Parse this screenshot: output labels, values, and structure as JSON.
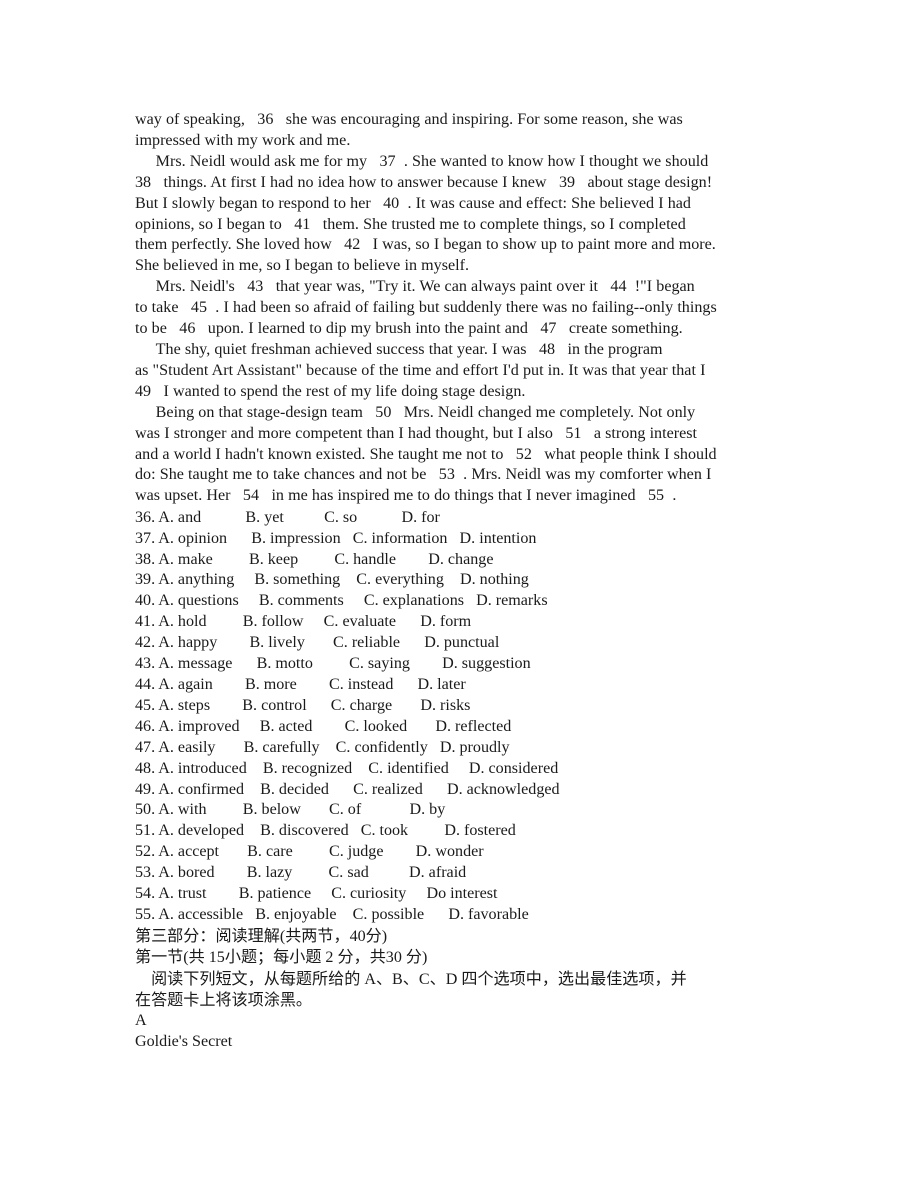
{
  "document": {
    "type": "scanned-exam-paper",
    "page_background": "#ffffff",
    "text_color": "#1a1a1a"
  },
  "cloze_passage": {
    "paragraphs": [
      "way of speaking,   36   she was encouraging and inspiring. For some reason, she was\nimpressed with my work and me.",
      "     Mrs. Neidl would ask me for my   37  . She wanted to know how I thought we should\n38   things. At first I had no idea how to answer because I knew   39   about stage design!\nBut I slowly began to respond to her   40  . It was cause and effect: She believed I had\nopinions, so I began to   41   them. She trusted me to complete things, so I completed\nthem perfectly. She loved how   42   I was, so I began to show up to paint more and more.\nShe believed in me, so I began to believe in myself.",
      "     Mrs. Neidl's   43   that year was, \"Try it. We can always paint over it   44  !\"I began\nto take   45  . I had been so afraid of failing but suddenly there was no failing--only things\nto be   46   upon. I learned to dip my brush into the paint and   47   create something.",
      "     The shy, quiet freshman achieved success that year. I was   48   in the program\nas \"Student Art Assistant\" because of the time and effort I'd put in. It was that year that I\n49   I wanted to spend the rest of my life doing stage design.",
      "     Being on that stage-design team   50   Mrs. Neidl changed me completely. Not only\nwas I stronger and more competent than I had thought, but I also   51   a strong interest\nand a world I hadn't known existed. She taught me not to   52   what people think I should\ndo: She taught me to take chances and not be   53  . Mrs. Neidl was my comforter when I\nwas upset. Her   54   in me has inspired me to do things that I never imagined   55  ."
    ]
  },
  "cloze_options": {
    "lines": [
      "36. A. and           B. yet          C. so           D. for",
      "37. A. opinion      B. impression   C. information   D. intention",
      "38. A. make         B. keep         C. handle        D. change",
      "39. A. anything     B. something    C. everything    D. nothing",
      "40. A. questions     B. comments     C. explanations   D. remarks",
      "41. A. hold         B. follow     C. evaluate      D. form",
      "42. A. happy        B. lively       C. reliable      D. punctual",
      "43. A. message      B. motto         C. saying        D. suggestion",
      "44. A. again        B. more        C. instead      D. later",
      "45. A. steps        B. control      C. charge       D. risks",
      "46. A. improved     B. acted        C. looked       D. reflected",
      "47. A. easily       B. carefully    C. confidently   D. proudly",
      "48. A. introduced    B. recognized    C. identified     D. considered",
      "49. A. confirmed    B. decided      C. realized      D. acknowledged",
      "50. A. with         B. below       C. of            D. by",
      "51. A. developed    B. discovered   C. took         D. fostered",
      "52. A. accept       B. care         C. judge        D. wonder",
      "53. A. bored        B. lazy         C. sad          D. afraid",
      "54. A. trust        B. patience     C. curiosity     Do interest",
      "55. A. accessible   B. enjoyable    C. possible      D. favorable"
    ],
    "items": [
      {
        "number": "36",
        "A": "and",
        "B": "yet",
        "C": "so",
        "D": "for"
      },
      {
        "number": "37",
        "A": "opinion",
        "B": "impression",
        "C": "information",
        "D": "intention"
      },
      {
        "number": "38",
        "A": "make",
        "B": "keep",
        "C": "handle",
        "D": "change"
      },
      {
        "number": "39",
        "A": "anything",
        "B": "something",
        "C": "everything",
        "D": "nothing"
      },
      {
        "number": "40",
        "A": "questions",
        "B": "comments",
        "C": "explanations",
        "D": "remarks"
      },
      {
        "number": "41",
        "A": "hold",
        "B": "follow",
        "C": "evaluate",
        "D": "form"
      },
      {
        "number": "42",
        "A": "happy",
        "B": "lively",
        "C": "reliable",
        "D": "punctual"
      },
      {
        "number": "43",
        "A": "message",
        "B": "motto",
        "C": "saying",
        "D": "suggestion"
      },
      {
        "number": "44",
        "A": "again",
        "B": "more",
        "C": "instead",
        "D": "later"
      },
      {
        "number": "45",
        "A": "steps",
        "B": "control",
        "C": "charge",
        "D": "risks"
      },
      {
        "number": "46",
        "A": "improved",
        "B": "acted",
        "C": "looked",
        "D": "reflected"
      },
      {
        "number": "47",
        "A": "easily",
        "B": "carefully",
        "C": "confidently",
        "D": "proudly"
      },
      {
        "number": "48",
        "A": "introduced",
        "B": "recognized",
        "C": "identified",
        "D": "considered"
      },
      {
        "number": "49",
        "A": "confirmed",
        "B": "decided",
        "C": "realized",
        "D": "acknowledged"
      },
      {
        "number": "50",
        "A": "with",
        "B": "below",
        "C": "of",
        "D": "by"
      },
      {
        "number": "51",
        "A": "developed",
        "B": "discovered",
        "C": "took",
        "D": "fostered"
      },
      {
        "number": "52",
        "A": "accept",
        "B": "care",
        "C": "judge",
        "D": "wonder"
      },
      {
        "number": "53",
        "A": "bored",
        "B": "lazy",
        "C": "sad",
        "D": "afraid"
      },
      {
        "number": "54",
        "A": "trust",
        "B": "patience",
        "C": "curiosity",
        "D": "Do interest"
      },
      {
        "number": "55",
        "A": "accessible",
        "B": "enjoyable",
        "C": "possible",
        "D": "favorable"
      }
    ]
  },
  "reading_section": {
    "part_heading": "第三部分：阅读理解(共两节，40分)",
    "subsection_heading": "第一节(共 15小题；每小题 2 分，共30 分)",
    "instruction": "    阅读下列短文，从每题所给的 A、B、C、D 四个选项中，选出最佳选项，并\n在答题卡上将该项涂黑。",
    "passage_label": "A",
    "passage_title": "Goldie's Secret"
  }
}
